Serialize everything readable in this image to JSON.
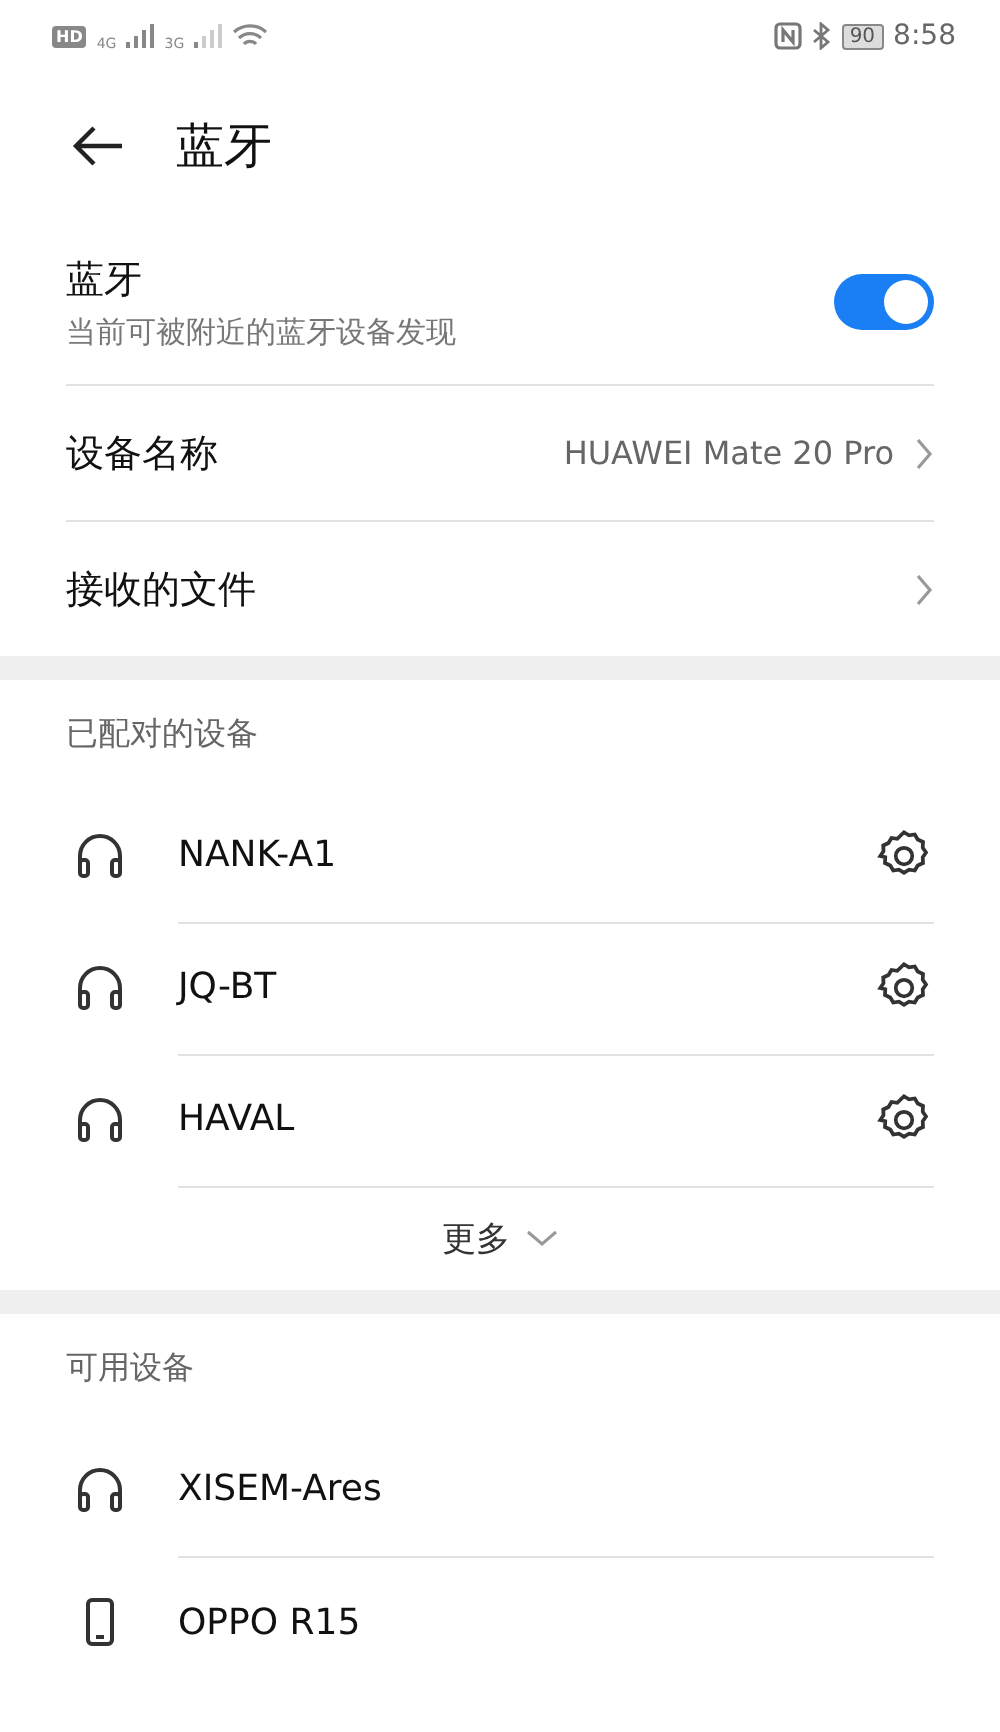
{
  "status_bar": {
    "hd": "HD",
    "network_1": "4G",
    "network_2": "3G",
    "battery": "90",
    "time": "8:58"
  },
  "header": {
    "title": "蓝牙"
  },
  "bluetooth": {
    "label": "蓝牙",
    "description": "当前可被附近的蓝牙设备发现",
    "on": true
  },
  "settings": [
    {
      "label": "设备名称",
      "value": "HUAWEI Mate 20 Pro"
    },
    {
      "label": "接收的文件"
    }
  ],
  "paired": {
    "title": "已配对的设备",
    "devices": [
      {
        "name": "NANK-A1",
        "kind": "headphones"
      },
      {
        "name": "JQ-BT",
        "kind": "headphones"
      },
      {
        "name": "HAVAL",
        "kind": "headphones"
      }
    ],
    "more": "更多"
  },
  "available": {
    "title": "可用设备",
    "devices": [
      {
        "name": "XISEM-Ares",
        "kind": "headphones"
      },
      {
        "name": "OPPO R15",
        "kind": "phone"
      }
    ]
  }
}
